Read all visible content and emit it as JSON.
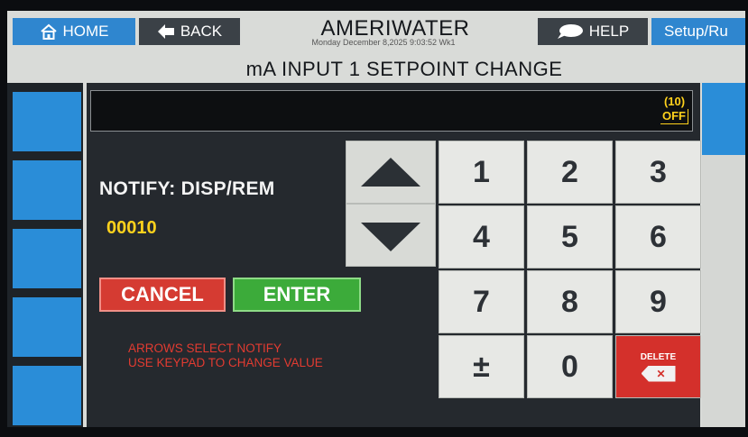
{
  "header": {
    "home_label": "HOME",
    "back_label": "BACK",
    "app_name": "AMERIWATER",
    "datetime": "Monday December 8,2025 9:03:52 Wk1",
    "help_label": "HELP",
    "setup_label": "Setup/Ru",
    "page_title": "mA INPUT 1 SETPOINT CHANGE"
  },
  "status": {
    "count": "(10)",
    "state": "OFF"
  },
  "notify_label": "NOTIFY: DISP/REM",
  "current_value": "00010",
  "buttons": {
    "cancel": "CANCEL",
    "enter": "ENTER"
  },
  "hint_lines": [
    "ARROWS SELECT NOTIFY",
    "USE KEYPAD TO CHANGE VALUE"
  ],
  "keypad": [
    "1",
    "2",
    "3",
    "4",
    "5",
    "6",
    "7",
    "8",
    "9",
    "±",
    "0"
  ],
  "delete_label": "DELETE",
  "colors": {
    "accent_blue": "#2a8dd8",
    "value_yellow": "#ffd21c",
    "cancel_red": "#d53b32",
    "enter_green": "#3cab3a"
  }
}
